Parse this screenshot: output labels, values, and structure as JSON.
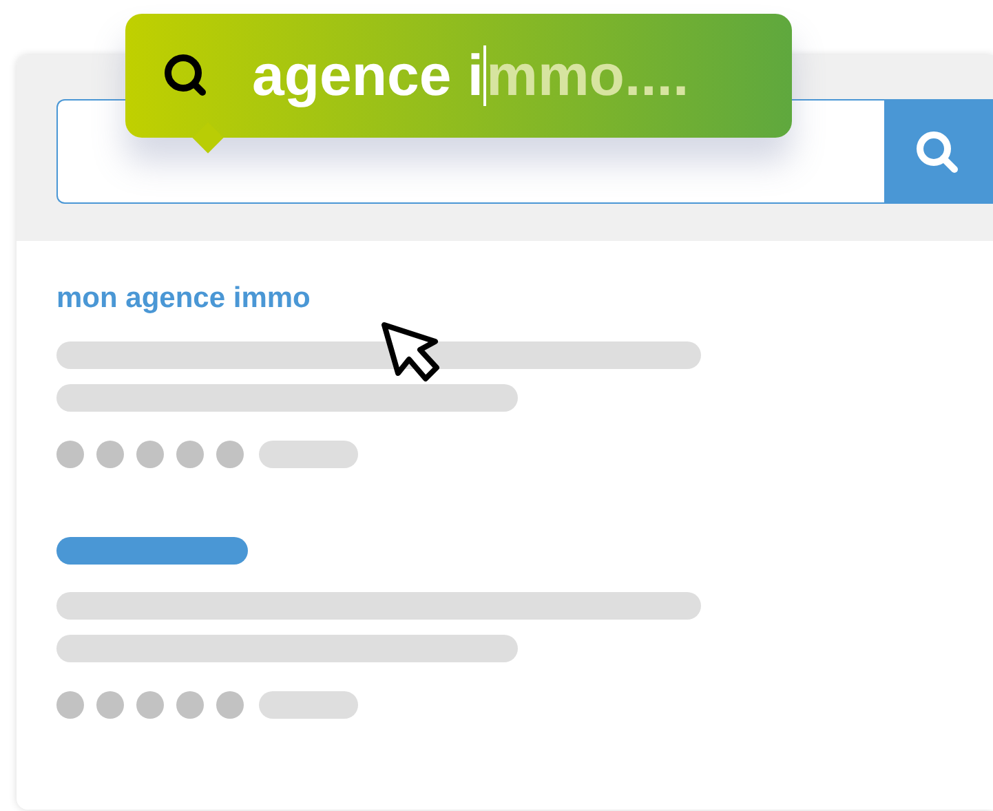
{
  "search_bubble": {
    "typed": "agence i",
    "suggestion": "mmo...."
  },
  "results": [
    {
      "kind": "text",
      "title": "mon agence immo"
    },
    {
      "kind": "bar"
    }
  ]
}
